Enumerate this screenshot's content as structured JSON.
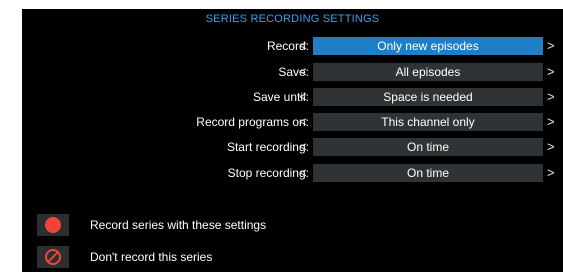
{
  "dialog": {
    "title": "SERIES RECORDING SETTINGS",
    "accent_color": "#3aa0e8",
    "selected_color": "#1f7ec6",
    "settings": [
      {
        "label": "Record:",
        "value": "Only new episodes",
        "selected": true
      },
      {
        "label": "Save:",
        "value": "All episodes",
        "selected": false
      },
      {
        "label": "Save until:",
        "value": "Space is needed",
        "selected": false
      },
      {
        "label": "Record programs on:",
        "value": "This channel only",
        "selected": false
      },
      {
        "label": "Start recording:",
        "value": "On time",
        "selected": false
      },
      {
        "label": "Stop recording:",
        "value": "On time",
        "selected": false
      }
    ],
    "chevron_left": "<",
    "chevron_right": ">",
    "actions": [
      {
        "icon": "record-dot-icon",
        "label": "Record series with these settings"
      },
      {
        "icon": "prohibited-icon",
        "label": "Don't record this series"
      }
    ]
  }
}
